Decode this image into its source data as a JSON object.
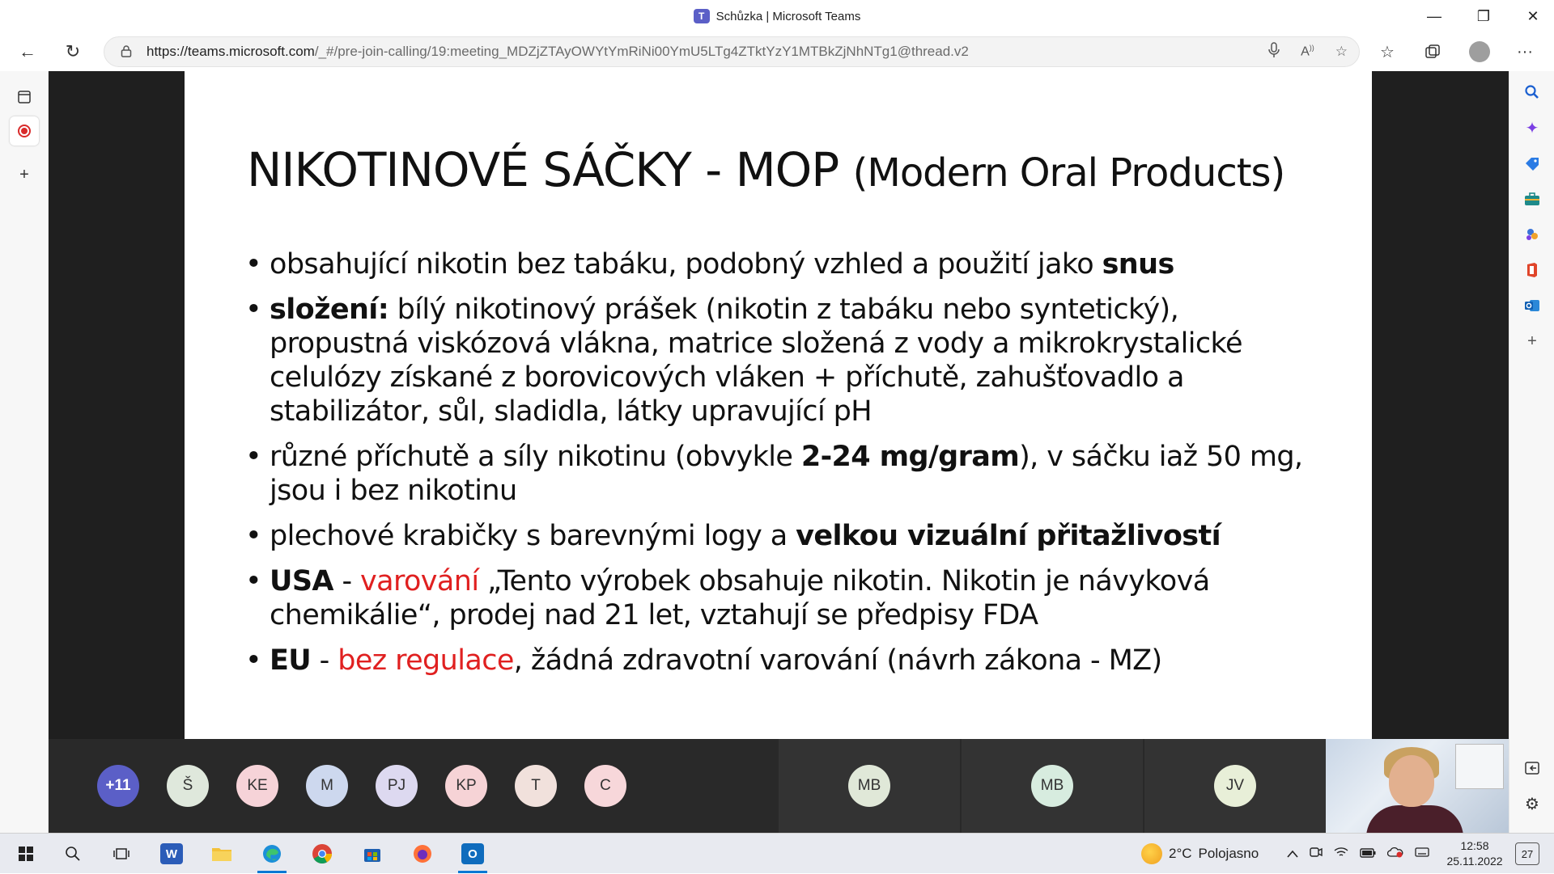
{
  "window": {
    "title": "Schůzka | Microsoft Teams",
    "minimize_glyph": "—",
    "restore_glyph": "❐",
    "close_glyph": "✕"
  },
  "browser": {
    "url_host": "https://teams.microsoft.com",
    "url_path": "/_#/pre-join-calling/19:meeting_MDZjZTAyOWYtYmRiNi00YmU5LTg4ZTktYzY1MTBkZjNhNTg1@thread.v2",
    "back_glyph": "←",
    "refresh_glyph": "↻",
    "menu_glyph": "···"
  },
  "slide": {
    "title_main": "NIKOTINOVÉ SÁČKY - MOP ",
    "title_sub": "(Modern Oral Products)",
    "b1_text": "obsahující nikotin bez tabáku, podobný vzhled a použití jako ",
    "b1_bold": "snus",
    "b2_bold": "složení:",
    "b2_text": " bílý nikotinový prášek (nikotin z tabáku nebo syntetický), propustná viskózová vlákna, matrice složená z vody a mikrokrystalické celulózy získané z borovicových vláken + příchutě, zahušťovadlo a stabilizátor, sůl, sladidla, látky upravující pH",
    "b3_text_a": "různé příchutě a síly nikotinu (obvykle ",
    "b3_bold": "2-24 mg/gram",
    "b3_text_b": "), v sáčku iaž 50 mg, jsou i bez nikotinu",
    "b4_text": "plechové krabičky s barevnými logy a ",
    "b4_bold": "velkou vizuální přitažlivostí",
    "b5_bold": "USA",
    "b5_dash": " - ",
    "b5_red": "varování",
    "b5_text": " „Tento výrobek obsahuje nikotin. Nikotin je návyková chemikálie“, prodej nad 21 let, vztahují se předpisy FDA",
    "b6_bold": "EU",
    "b6_dash": " - ",
    "b6_red": "bez regulace",
    "b6_text": ", žádná zdravotní varování (návrh zákona - MZ)"
  },
  "participants": {
    "more": "+11",
    "p1": "Š",
    "p2": "KE",
    "p3": "M",
    "p4": "PJ",
    "p5": "KP",
    "p6": "T",
    "p7": "C",
    "p8": "MB",
    "p9": "MB",
    "p10": "JV"
  },
  "taskbar": {
    "weather_temp": "2°C",
    "weather_text": "Polojasno",
    "time": "12:58",
    "date": "25.11.2022",
    "notifications": "27"
  },
  "colors": {
    "accent_red": "#e02020",
    "teams_purple": "#5b5fc7",
    "stage_bg": "#1f1f1f"
  }
}
